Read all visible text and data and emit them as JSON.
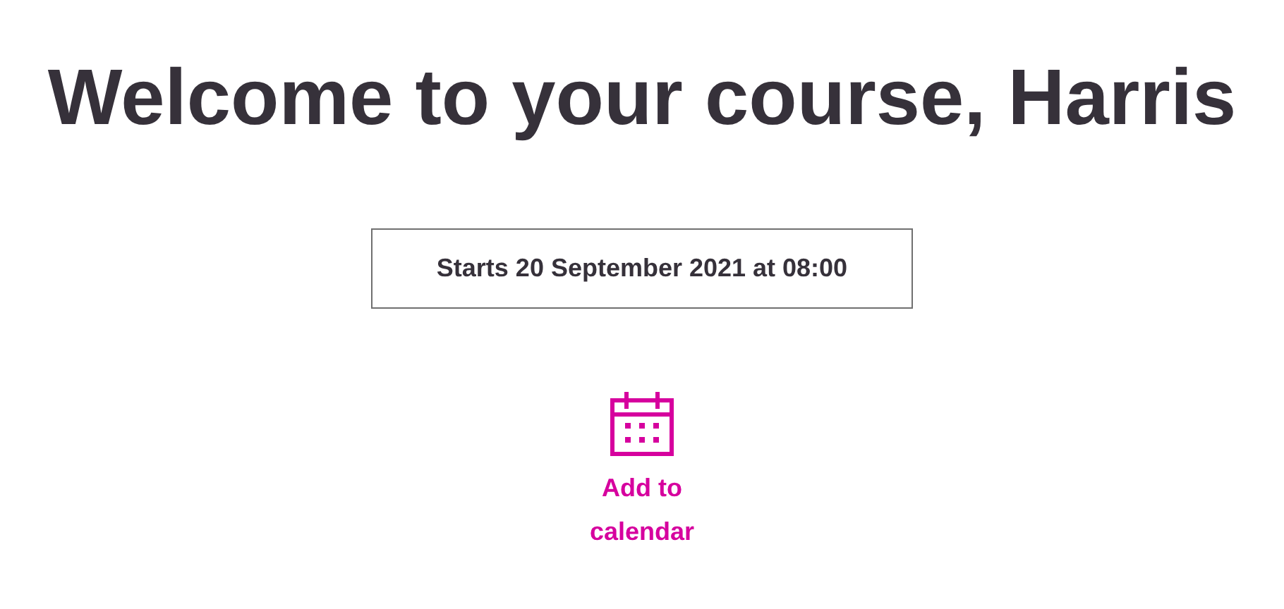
{
  "heading": "Welcome to your course, Harris",
  "start_info": "Starts 20 September 2021 at 08:00",
  "calendar_link": {
    "label": "Add to calendar"
  }
}
